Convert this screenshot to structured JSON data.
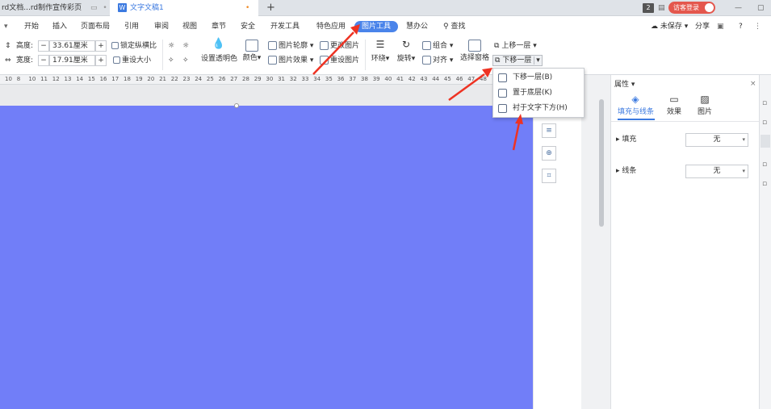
{
  "tabs": [
    {
      "label": "rd文档...rd制作宣传彩页"
    },
    {
      "label": "文字文稿1"
    }
  ],
  "tabbar": {
    "new_tab": "+",
    "page_badge": "2",
    "login_label": "访客登录"
  },
  "menubar": {
    "items": [
      "开始",
      "插入",
      "页面布局",
      "引用",
      "审阅",
      "视图",
      "章节",
      "安全",
      "开发工具",
      "特色应用",
      "图片工具",
      "慧办公"
    ],
    "search_label": "查找",
    "unsaved_label": "未保存",
    "share_label": "分享",
    "help_label": "?"
  },
  "ribbon": {
    "height_label": "高度:",
    "height_value": "33.61厘米",
    "width_label": "宽度:",
    "width_value": "17.91厘米",
    "minus": "−",
    "plus": "+",
    "lock_ratio": "锁定纵横比",
    "reset_size": "重设大小",
    "set_transparent": "设置透明色",
    "color": "颜色",
    "outline": "图片轮廓",
    "effect": "图片效果",
    "change_picture": "更改图片",
    "reset_picture": "重设图片",
    "wrap": "环绕",
    "rotate": "旋转",
    "group": "组合",
    "align": "对齐",
    "selection_pane": "选择窗格",
    "bring_forward": "上移一层",
    "send_backward": "下移一层"
  },
  "ruler": {
    "numbers": [
      "10",
      "8",
      "10",
      "11",
      "12",
      "13",
      "14",
      "15",
      "16",
      "17",
      "18",
      "19",
      "20",
      "21",
      "22",
      "23",
      "24",
      "25",
      "26",
      "27",
      "28",
      "29",
      "30",
      "31",
      "32",
      "33",
      "34",
      "35",
      "36",
      "37",
      "38",
      "39",
      "40",
      "41",
      "42",
      "43",
      "44",
      "45",
      "46",
      "47",
      "48"
    ]
  },
  "dropdown": {
    "items": [
      {
        "label": "下移一层(B)",
        "icon": "send-backward-icon"
      },
      {
        "label": "置于底层(K)",
        "icon": "send-to-back-icon"
      },
      {
        "label": "衬于文字下方(H)",
        "icon": "behind-text-icon"
      }
    ]
  },
  "props": {
    "title": "属性",
    "tabs": [
      {
        "label": "填充与线条"
      },
      {
        "label": "效果"
      },
      {
        "label": "图片"
      }
    ],
    "fill_label": "填充",
    "fill_value": "无",
    "line_label": "线条",
    "line_value": "无"
  },
  "colors": {
    "doc_page": "#717ef8",
    "accent": "#4a84ea",
    "arrow": "#ee3323"
  }
}
